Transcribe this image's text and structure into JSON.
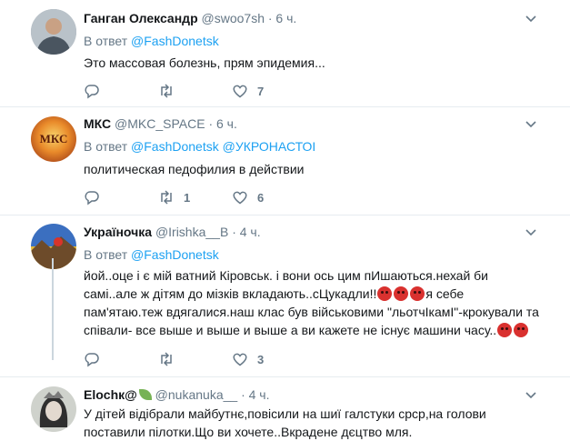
{
  "icons": [
    "chevron-down-icon",
    "reply-icon",
    "retweet-icon",
    "like-icon",
    "angry-face-emoji",
    "herb-emoji"
  ],
  "colors": {
    "link": "#1da1f2",
    "meta": "#657786",
    "text": "#14171a",
    "divider": "#e6ecf0",
    "emoji_red": "#d9312f"
  },
  "tweets": [
    {
      "name": "Ганган Олександр",
      "handle": "@swoo7sh",
      "time": "· 6 ч.",
      "reply_prefix": "В ответ",
      "reply_to": [
        "@FashDonetsk"
      ],
      "text": [
        "Это массовая болезнь, прям эпидемия..."
      ],
      "counts": {
        "reply": "",
        "retweet": "",
        "like": "7"
      }
    },
    {
      "name": "МКС",
      "handle": "@MKC_SPACE",
      "time": "· 6 ч.",
      "avatar_text": "МКС",
      "reply_prefix": "В ответ",
      "reply_to": [
        "@FashDonetsk",
        "@УКРОНАСТОІ"
      ],
      "text": [
        "политическая педофилия в действии"
      ],
      "counts": {
        "reply": "",
        "retweet": "1",
        "like": "6"
      }
    },
    {
      "name": "Україночка",
      "handle": "@Irishka__B",
      "time": "· 4 ч.",
      "reply_prefix": "В ответ",
      "reply_to": [
        "@FashDonetsk"
      ],
      "text": [
        "йой..оце і є мій ватний Кіровськ. і вони ось цим пИшаються.нехай би",
        "самі..але ж дітям до мізків вкладають..сЦукадли!!",
        "я себе",
        "пам'ятаю.теж вдягалися.наш клас був військовими \"льотчІкамІ\"-крокували та",
        "співали- все выше и выше и выше а ви кажете не існує машини часу.."
      ],
      "counts": {
        "reply": "",
        "retweet": "",
        "like": "3"
      }
    },
    {
      "name": "Elochк@",
      "handle": "@nukanuka__",
      "time": "· 4 ч.",
      "text": [
        "У дітей відібрали майбутнє,повісили на шиї галстуки срср,на голови",
        "поставили пілотки.Що ви хочете..Вкрадене дєцтво мля."
      ]
    }
  ]
}
